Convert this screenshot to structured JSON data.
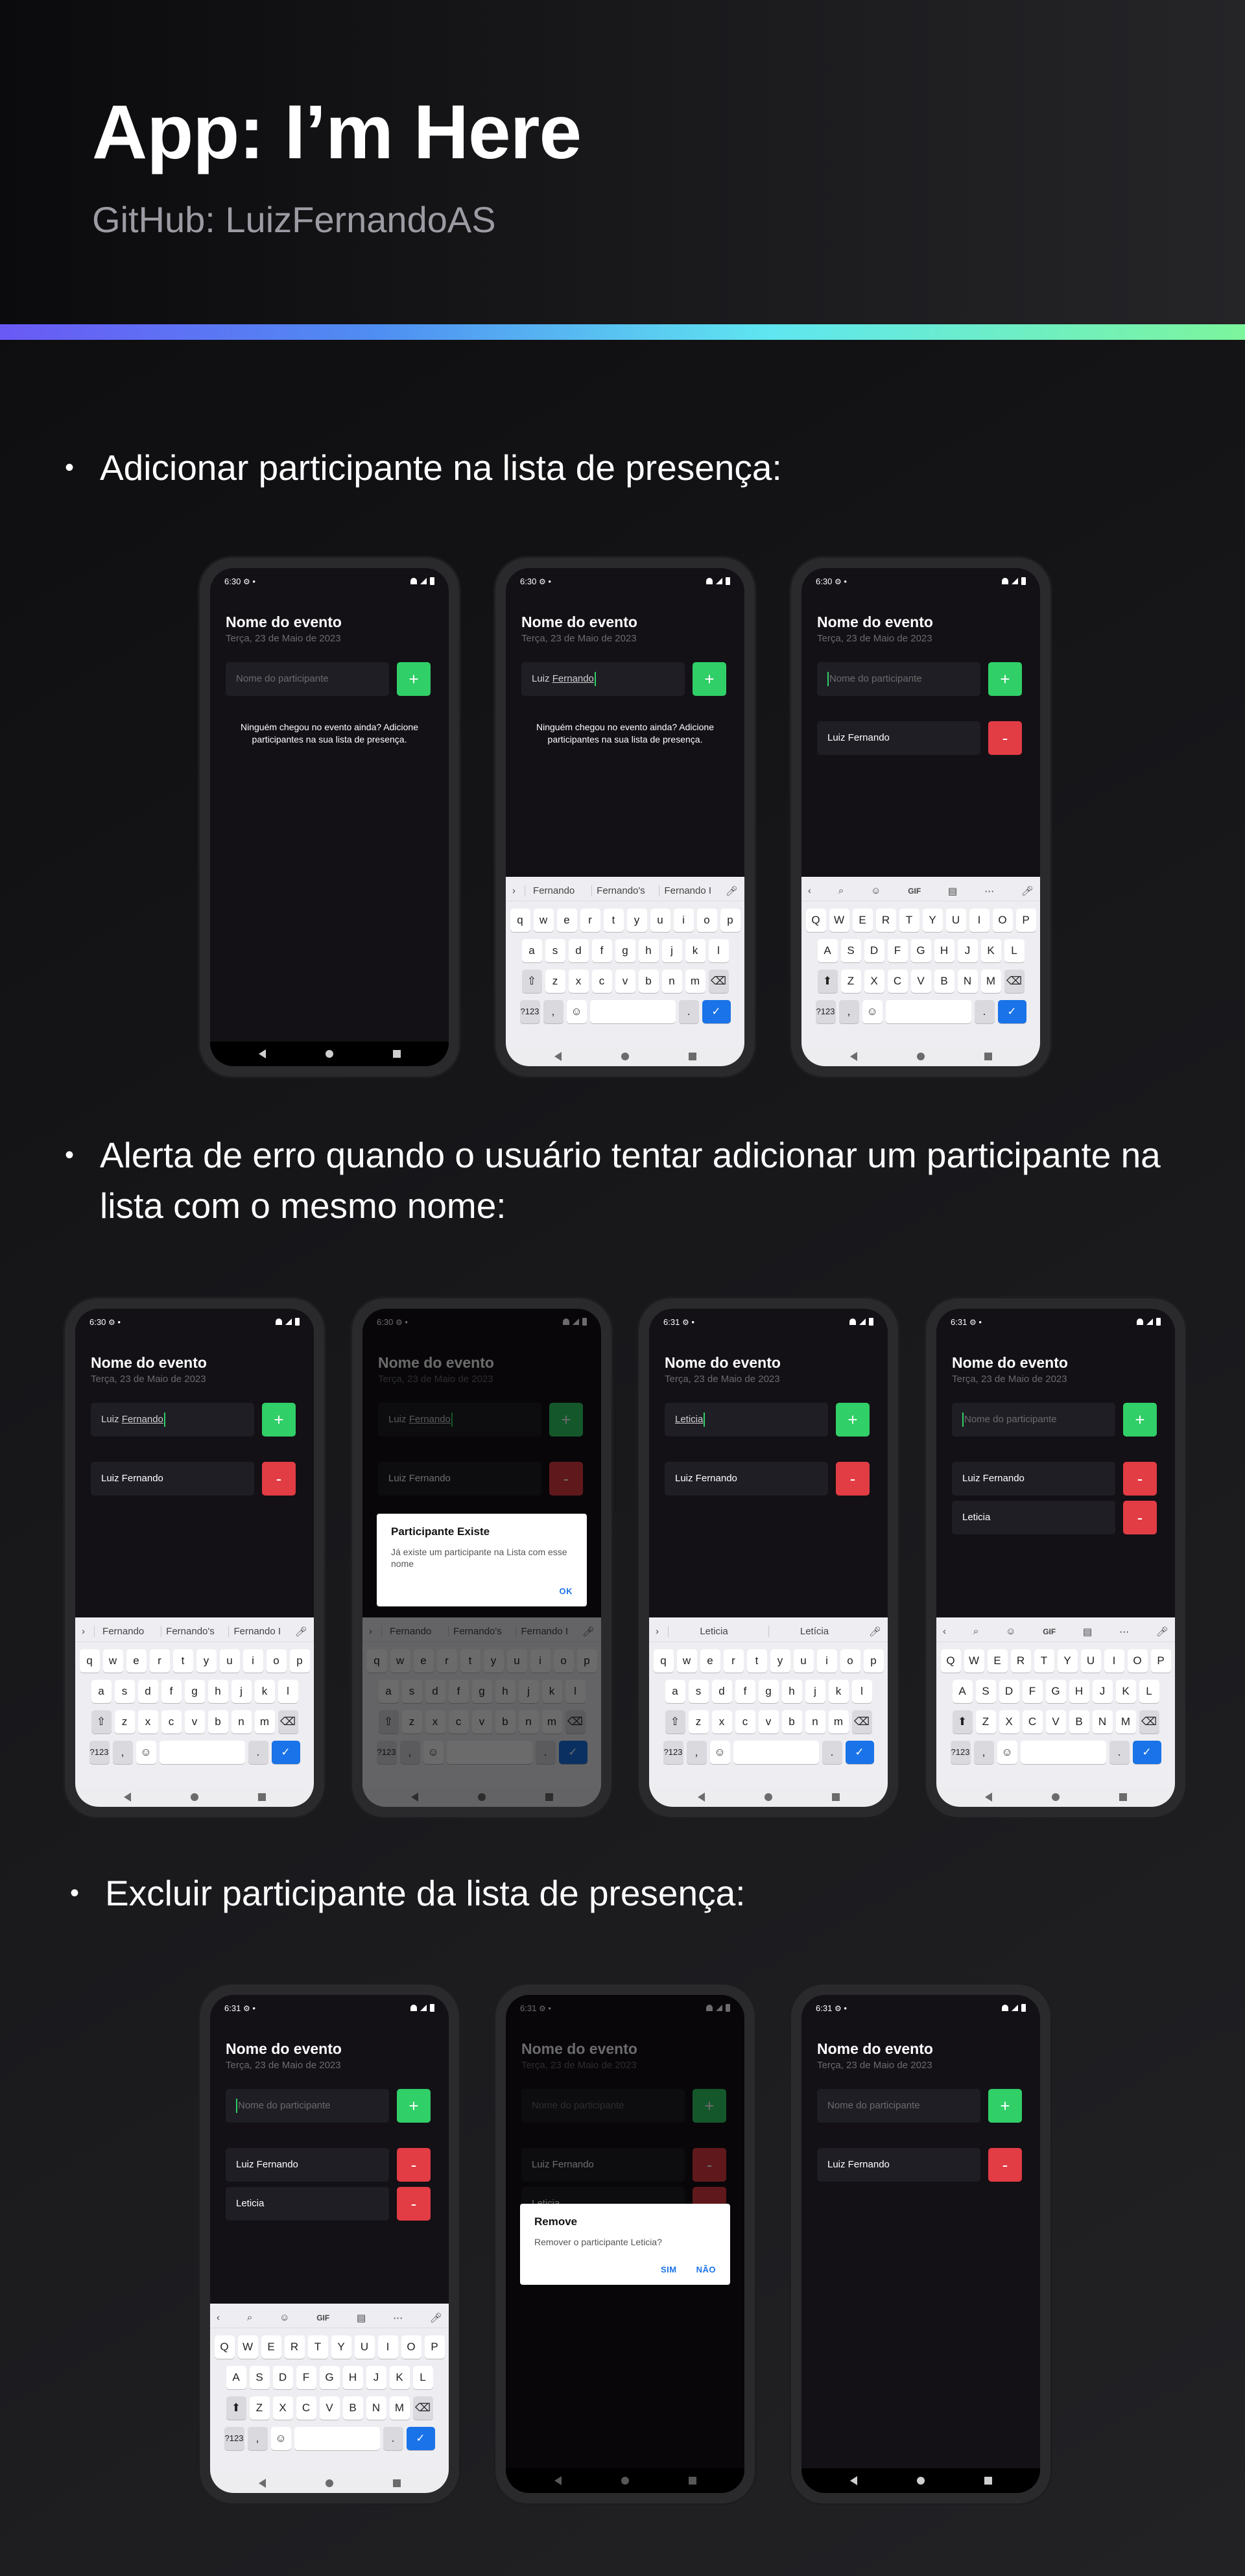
{
  "header": {
    "title": "App: I’m Here",
    "subtitle": "GitHub: LuizFernandoAS"
  },
  "sections": [
    {
      "label": "Adicionar participante na lista de presença:"
    },
    {
      "label": "Alerta de erro quando o usuário tentar adicionar um participante na lista com o mesmo nome:"
    },
    {
      "label": "Excluir participante da lista de presença:"
    }
  ],
  "app": {
    "event_title": "Nome do evento",
    "event_date": "Terça, 23 de Maio de 2023",
    "input_placeholder": "Nome do participante",
    "add_label": "+",
    "remove_label": "-",
    "empty_message": "Ninguém chegou no evento ainda? Adicione participantes na sua lista de presença.",
    "participant_1": "Luiz Fernando",
    "participant_2": "Leticia",
    "typed_name": "Luiz Fernando",
    "typed_name_prefix": "Luiz ",
    "typed_name_suffix": "Fernando",
    "typed_leticia": "Leticia"
  },
  "status_bar": {
    "time_a": "6:30",
    "time_b": "6:31"
  },
  "keyboard": {
    "suggestions_fernando": [
      "Fernando",
      "Fernando's",
      "Fernando I"
    ],
    "suggestions_leticia": [
      "Leticia",
      "Letícia"
    ],
    "toolbar_icons": [
      "chevron-left-icon",
      "search-icon",
      "sticker-icon",
      "GIF",
      "clipboard-icon",
      "more-icon",
      "mic-icon"
    ],
    "row1_lower": "qwertyuiop",
    "row2_lower": "asdfghjkl",
    "row3_lower": "zxcvbnm",
    "row1_upper": "QWERTYUIOP",
    "row2_upper": "ASDFGHJKL",
    "row3_upper": "ZXCVBNM",
    "sym_label": "?123",
    "comma": ",",
    "period": ".",
    "emoji": "☺",
    "gif": "GIF"
  },
  "dialogs": {
    "exists_title": "Participante Existe",
    "exists_message": "Já existe um participante na Lista com esse nome",
    "exists_ok": "OK",
    "remove_title": "Remove",
    "remove_message": "Remover o participante Leticia?",
    "remove_yes": "SIM",
    "remove_no": "NÃO"
  },
  "colors": {
    "green": "#31cf67",
    "red": "#e23c44",
    "background": "#131016",
    "input": "#1f1e25",
    "gradient": [
      "#6a59f5",
      "#5fe6f0",
      "#7cf59c"
    ]
  }
}
